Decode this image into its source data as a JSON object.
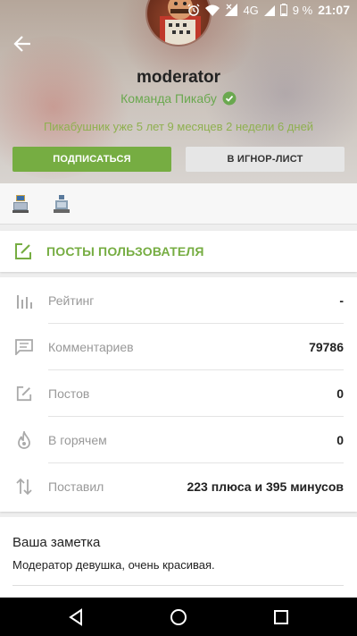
{
  "status": {
    "network": "4G",
    "battery": "9 %",
    "time": "21:07"
  },
  "profile": {
    "username": "moderator",
    "team": "Команда Пикабу",
    "tenure": "Пикабушник уже 5 лет 9 месяцев 2 недели 6 дней",
    "subscribe_label": "ПОДПИСАТЬСЯ",
    "ignore_label": "В ИГНОР-ЛИСТ"
  },
  "posts_link": {
    "label": "ПОСТЫ ПОЛЬЗОВАТЕЛЯ"
  },
  "stats": [
    {
      "label": "Рейтинг",
      "value": "-",
      "icon": "rating-bars-icon"
    },
    {
      "label": "Комментариев",
      "value": "79786",
      "icon": "comment-icon"
    },
    {
      "label": "Постов",
      "value": "0",
      "icon": "edit-post-icon"
    },
    {
      "label": "В горячем",
      "value": "0",
      "icon": "flame-icon"
    },
    {
      "label": "Поставил",
      "value": "223 плюса и 395 минусов",
      "icon": "up-down-arrows-icon"
    }
  ],
  "note": {
    "title": "Ваша заметка",
    "text": "Модератор девушка, очень красивая."
  },
  "colors": {
    "accent": "#76ad42",
    "team_green": "#6aa84f",
    "muted": "#999999"
  }
}
